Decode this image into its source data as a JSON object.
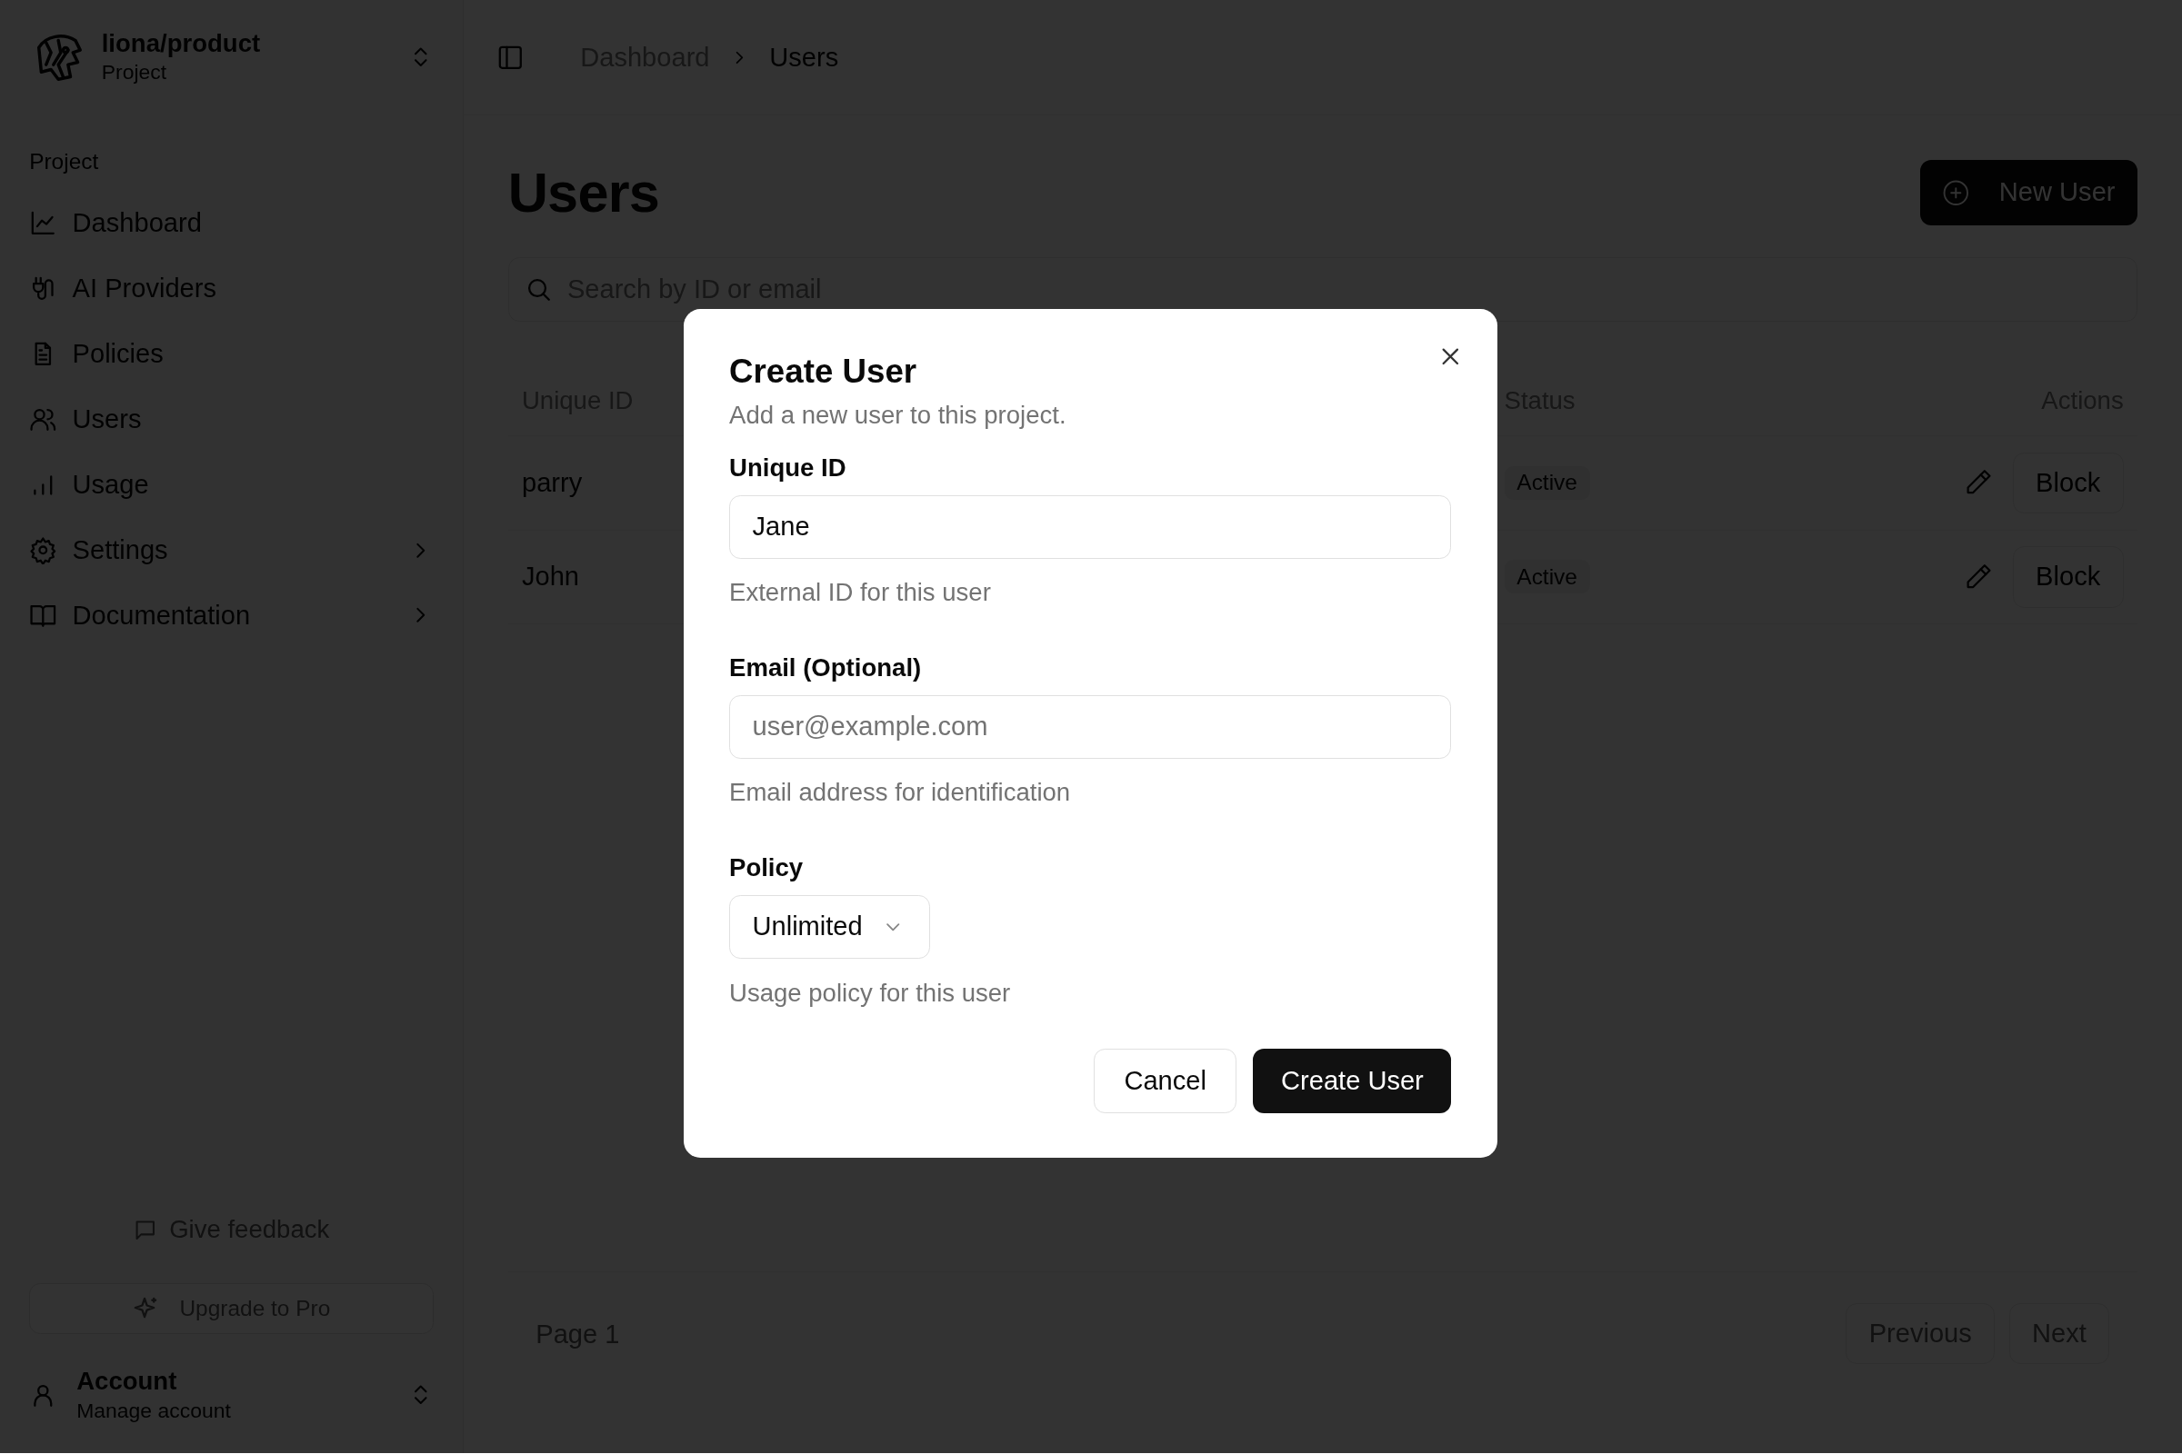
{
  "sidebar": {
    "project": {
      "name": "liona/product",
      "subtitle": "Project"
    },
    "section_label": "Project",
    "items": [
      {
        "label": "Dashboard",
        "has_submenu": false
      },
      {
        "label": "AI Providers",
        "has_submenu": false
      },
      {
        "label": "Policies",
        "has_submenu": false
      },
      {
        "label": "Users",
        "has_submenu": false
      },
      {
        "label": "Usage",
        "has_submenu": false
      },
      {
        "label": "Settings",
        "has_submenu": true
      },
      {
        "label": "Documentation",
        "has_submenu": true
      }
    ],
    "feedback": "Give feedback",
    "upgrade": "Upgrade to Pro",
    "account": {
      "title": "Account",
      "subtitle": "Manage account"
    }
  },
  "breadcrumbs": [
    "Dashboard",
    "Users"
  ],
  "page": {
    "title": "Users",
    "new_button": "New User",
    "search": {
      "placeholder": "Search by ID or email"
    },
    "table": {
      "columns": [
        "Unique ID",
        "Status",
        "Actions"
      ],
      "rows": [
        {
          "unique_id": "parry",
          "status": "Active",
          "action": "Block"
        },
        {
          "unique_id": "John",
          "status": "Active",
          "action": "Block"
        }
      ]
    },
    "pagination": {
      "page": "Page 1",
      "previous": "Previous",
      "next": "Next"
    }
  },
  "dialog": {
    "title": "Create User",
    "description": "Add a new user to this project.",
    "fields": [
      {
        "kind": "text",
        "label": "Unique ID",
        "value": "Jane",
        "help": "External ID for this user"
      },
      {
        "kind": "text",
        "label": "Email (Optional)",
        "placeholder": "user@example.com",
        "help": "Email address for identification"
      },
      {
        "kind": "select",
        "label": "Policy",
        "value": "Unlimited",
        "help": "Usage policy for this user"
      }
    ],
    "cancel": "Cancel",
    "submit": "Create User"
  }
}
